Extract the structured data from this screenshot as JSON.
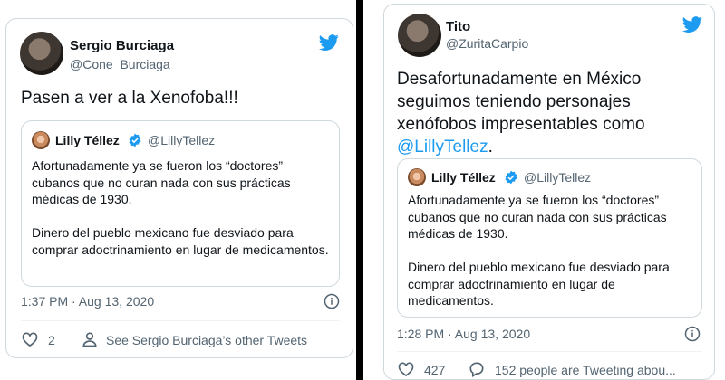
{
  "colors": {
    "accent": "#1d9bf0",
    "text": "#0f1419",
    "muted": "#536471",
    "border": "#cfd9de"
  },
  "left_tweet": {
    "author_name": "Sergio Burciaga",
    "author_handle": "@Cone_Burciaga",
    "text": "Pasen a ver a la Xenofoba!!!",
    "quoted": {
      "author_name": "Lilly Téllez",
      "author_handle": "@LillyTellez",
      "body": "Afortunadamente ya se fueron los “doctores” cubanos que no curan nada con sus prácticas médicas de 1930.\n\nDinero del pueblo mexicano fue desviado para comprar adoctrinamiento en lugar de medicamentos."
    },
    "timestamp": "1:37 PM · Aug 13, 2020",
    "like_count": "2",
    "profile_link": "See Sergio Burciaga’s other Tweets"
  },
  "right_tweet": {
    "author_name": "Tito",
    "author_handle": "@ZuritaCarpio",
    "text_line1": "Desafortunadamente en México",
    "text_line2": "seguimos teniendo personajes",
    "text_line3": "xenófobos impresentables como",
    "mention": "@LillyTellez",
    "text_end": ".",
    "quoted": {
      "author_name": "Lilly Téllez",
      "author_handle": "@LillyTellez",
      "body": "Afortunadamente ya se fueron los “doctores” cubanos que no curan nada con sus prácticas médicas de 1930.\n\nDinero del pueblo mexicano fue desviado para comprar adoctrinamiento en lugar de medicamentos."
    },
    "timestamp": "1:28 PM · Aug 13, 2020",
    "like_count": "427",
    "conversation_text": "152 people are Tweeting abou..."
  },
  "icons": {
    "bird": "twitter-bird-icon",
    "verified": "verified-badge-icon",
    "info": "info-icon",
    "heart": "heart-icon",
    "person": "person-icon",
    "reply": "reply-bubble-icon"
  }
}
